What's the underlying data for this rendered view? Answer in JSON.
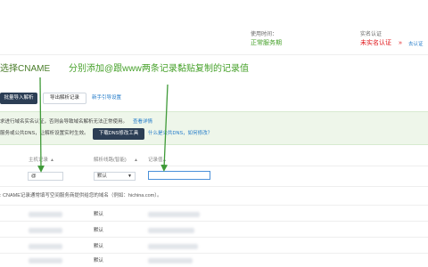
{
  "top_right": {
    "use_time_label": "使用时间：",
    "use_time_value": "正常服务期",
    "real_name_label": "实名认证",
    "real_name_value": "未实名认证",
    "real_name_arrow": "»",
    "go_verify_link": "去认证"
  },
  "annotation": {
    "cname_heading": "选择CNAME",
    "cname_instruction": "分别添加@跟www两条记录",
    "paste_instruction": "黏贴复制的记录值"
  },
  "toolbar": {
    "batch_import": "批量导入解析",
    "export": "导出解析记录",
    "new_guide": "新手引导设置"
  },
  "notice": {
    "line1": "求进行域名实名认证，否则会导致域名解析无法正常使用。",
    "line1_link": "查看详情",
    "line2": "服务或公共DNS，让解析设置实时生效。",
    "download_button": "下载DNS修改工具",
    "line2_link": "什么是公共DNS，如何修改？"
  },
  "table": {
    "col_host": "主机记录",
    "col_line": "解析线路(智能)",
    "col_value": "记录值",
    "sort_icon": "▲"
  },
  "edit_row": {
    "host_value": "@",
    "line_value": "默认",
    "record_value": ""
  },
  "hint": ": CNAME记录通常填写空间服务商提供给您的域名（例如：hichina.com）。",
  "rows": [
    {
      "line": "默认"
    },
    {
      "line": "默认"
    },
    {
      "line": "默认"
    },
    {
      "line": "默认"
    },
    {
      "line": "默认"
    }
  ],
  "colors": {
    "green": "#46a12a",
    "red": "#e0161a",
    "blue": "#1e78c8",
    "arrow_green": "#3f9a38"
  }
}
